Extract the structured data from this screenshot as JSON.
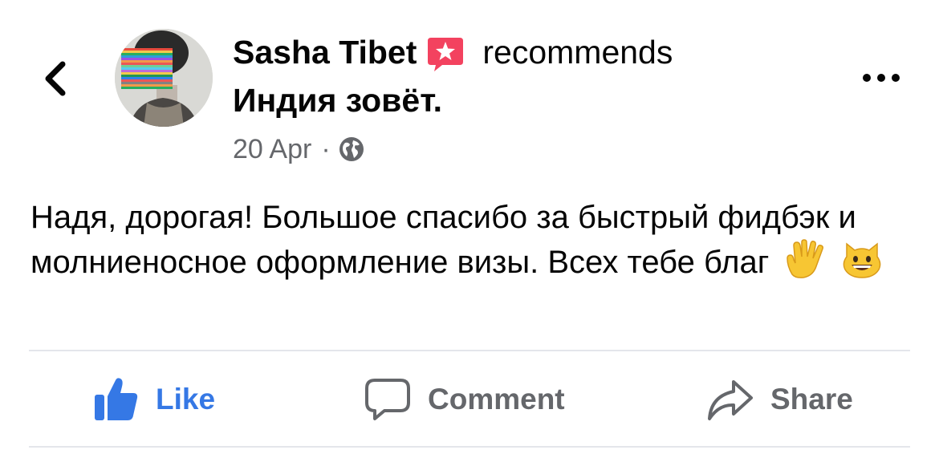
{
  "header": {
    "back_icon": "chevron-left-icon",
    "author": "Sasha Tibet",
    "badge_icon": "star-recommend-badge-icon",
    "action_text": "recommends",
    "page_name": "Индия зовёт.",
    "date": "20 Apr",
    "separator": "·",
    "privacy_icon": "globe-icon",
    "more_icon": "more-dots-icon"
  },
  "post": {
    "text": "Надя, дорогая! Большое спасибо за быстрый фидбэк и молниеносное оформление визы. Всех тебе благ",
    "emojis": [
      "vulcan-salute-emoji",
      "grinning-cat-emoji"
    ]
  },
  "actions": [
    {
      "label": "Like",
      "icon": "thumbs-up-icon",
      "color": "#3578e5"
    },
    {
      "label": "Comment",
      "icon": "comment-bubble-icon",
      "color": "#65676b"
    },
    {
      "label": "Share",
      "icon": "share-arrow-icon",
      "color": "#65676b"
    }
  ],
  "colors": {
    "text": "#050505",
    "secondary": "#65676b",
    "badge": "#f3425f",
    "divider": "#e4e6eb"
  }
}
